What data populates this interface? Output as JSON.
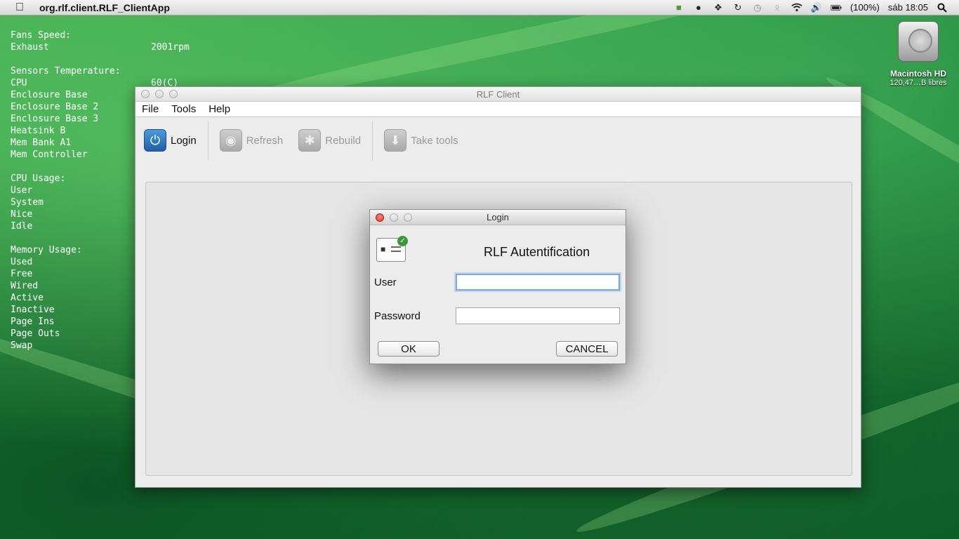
{
  "menubar": {
    "app_name": "org.rlf.client.RLF_ClientApp",
    "battery": "(100%)",
    "clock": "sáb 18:05"
  },
  "stats": {
    "fans_header": "Fans Speed:",
    "fans": [
      {
        "label": "Exhaust",
        "value": "2001rpm"
      }
    ],
    "sensors_header": "Sensors Temperature:",
    "sensors": [
      {
        "label": "CPU",
        "value": "60(C)"
      },
      {
        "label": "Enclosure Base",
        "value": ""
      },
      {
        "label": "Enclosure Base 2",
        "value": ""
      },
      {
        "label": "Enclosure Base 3",
        "value": ""
      },
      {
        "label": "Heatsink B",
        "value": ""
      },
      {
        "label": "Mem Bank A1",
        "value": ""
      },
      {
        "label": "Mem Controller",
        "value": ""
      }
    ],
    "cpu_header": "CPU Usage:",
    "cpu": [
      "User",
      "System",
      "Nice",
      "Idle"
    ],
    "mem_header": "Memory Usage:",
    "mem": [
      "Used",
      "Free",
      "Wired",
      "Active",
      "Inactive",
      "Page Ins",
      "Page Outs",
      "Swap"
    ]
  },
  "disk": {
    "name": "Macintosh HD",
    "free": "120,47…B libres"
  },
  "mainwin": {
    "title": "RLF Client",
    "menu": [
      "File",
      "Tools",
      "Help"
    ],
    "toolbar": {
      "login": "Login",
      "refresh": "Refresh",
      "rebuild": "Rebuild",
      "take_tools": "Take tools"
    }
  },
  "dialog": {
    "title": "Login",
    "heading": "RLF Autentification",
    "user_label": "User",
    "user_value": "",
    "password_label": "Password",
    "password_value": "",
    "ok": "OK",
    "cancel": "CANCEL"
  }
}
